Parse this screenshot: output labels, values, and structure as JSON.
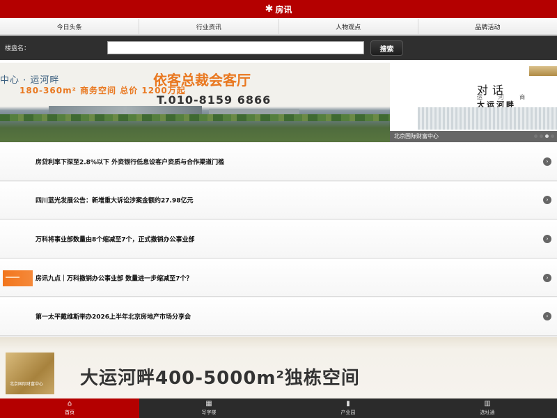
{
  "header": {
    "logo_mark": "✱",
    "logo_text": "房讯"
  },
  "nav": {
    "tabs": [
      {
        "label": "今日头条"
      },
      {
        "label": "行业资讯"
      },
      {
        "label": "人物观点"
      },
      {
        "label": "品牌活动"
      }
    ]
  },
  "search": {
    "label": "楼盘名：",
    "value": "",
    "placeholder": "",
    "button_label": "搜索"
  },
  "banner": {
    "slide1": {
      "line1": "中心 · 运河畔",
      "accent": "依客总裁会客厅",
      "line2": "180-360m² 商务空间  总价 1200万起",
      "phone": "T.010-8159 6866"
    },
    "slide2": {
      "line1": "对话",
      "line2": "运 河 商",
      "line3": "大运河畔"
    },
    "caption": "北京国际财富中心",
    "active_slide": 3,
    "slide_count": 4
  },
  "news": [
    {
      "title": "房贷利率下探至2.8%以下 外资银行低息设客户资质与合作渠道门槛",
      "has_thumb": false
    },
    {
      "title": "四川蓝光发展公告：新增重大诉讼涉案金额约27.98亿元",
      "has_thumb": false
    },
    {
      "title": "万科将事业部数量由8个缩减至7个，正式撤销办公事业部",
      "has_thumb": false
    },
    {
      "title": "房讯九点｜万科撤销办公事业部 数量进一步缩减至7个？",
      "has_thumb": true
    },
    {
      "title": "第一太平戴维斯举办2026上半年北京房地产市场分享会",
      "has_thumb": false
    }
  ],
  "ad": {
    "title": "大运河畔400-5000m²独栋空间",
    "logo_caption": "北京国际财富中心"
  },
  "tabbar": {
    "tabs": [
      {
        "label": "首页",
        "icon": "home-icon",
        "glyph": "⌂",
        "active": true
      },
      {
        "label": "写字楼",
        "icon": "office-building-icon",
        "glyph": "▦",
        "active": false
      },
      {
        "label": "产业园",
        "icon": "industrial-park-icon",
        "glyph": "▮",
        "active": false
      },
      {
        "label": "选址通",
        "icon": "site-selection-icon",
        "glyph": "▥",
        "active": false
      }
    ]
  },
  "colors": {
    "brand_red": "#b40000",
    "dark_bar": "#2f2f2f",
    "accent_orange": "#e97820"
  }
}
